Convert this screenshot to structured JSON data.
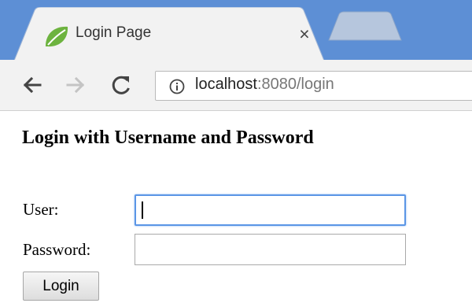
{
  "browser": {
    "tab": {
      "title": "Login Page",
      "close_glyph": "×",
      "favicon": "spring-leaf-icon"
    },
    "new_tab": {
      "icon": "new-tab-icon"
    },
    "nav": {
      "back_icon": "back-arrow-icon",
      "forward_icon": "forward-arrow-icon",
      "reload_icon": "reload-icon"
    },
    "address_bar": {
      "icon": "info-icon",
      "host": "localhost",
      "rest": ":8080/login"
    },
    "colors": {
      "tabstrip": "#5d8fd5",
      "toolbar": "#f2f2f2",
      "favicon_green": "#6db33f"
    }
  },
  "page": {
    "heading": "Login with Username and Password",
    "form": {
      "user_label": "User:",
      "user_value": "",
      "password_label": "Password:",
      "password_value": "",
      "submit_label": "Login"
    },
    "colors": {
      "focus_border": "#5b96e6"
    }
  }
}
